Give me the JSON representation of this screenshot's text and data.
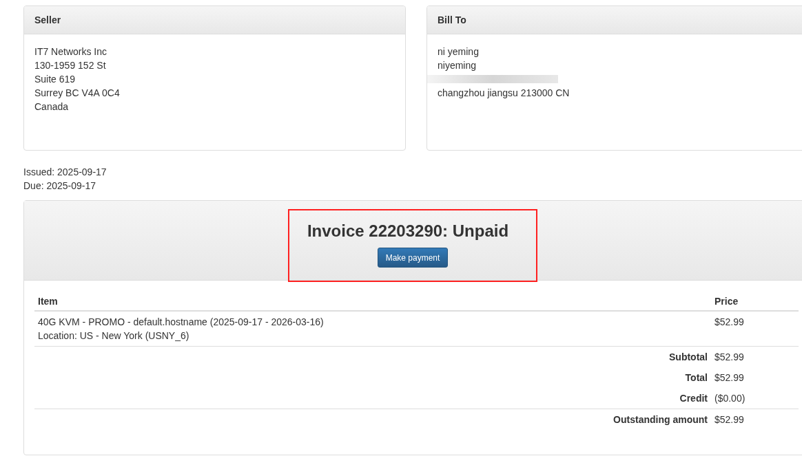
{
  "seller": {
    "title": "Seller",
    "lines": [
      "IT7 Networks Inc",
      "130-1959 152 St",
      "Suite 619",
      "Surrey BC V4A 0C4",
      "Canada"
    ]
  },
  "bill_to": {
    "title": "Bill To",
    "lines": [
      "ni yeming",
      "niyeming",
      "changzhou jiangsu 213000 CN"
    ],
    "redacted": true
  },
  "dates": [
    "Issued: 2025-09-17",
    "Due: 2025-09-17"
  ],
  "invoice": {
    "title": "Invoice 22203290: Unpaid",
    "button": "Make payment",
    "highlighted": true
  },
  "table": {
    "columns": [
      "Item",
      "Price"
    ],
    "rows": [
      {
        "item": [
          "40G KVM - PROMO - default.hostname (2025-09-17 - 2026-03-16)",
          "Location: US - New York (USNY_6)"
        ],
        "price": "$52.99"
      }
    ],
    "totals": [
      {
        "label": "Subtotal",
        "value": "$52.99",
        "divider": false
      },
      {
        "label": "Total",
        "value": "$52.99",
        "divider": false
      },
      {
        "label": "Credit",
        "value": "($0.00)",
        "divider": false
      },
      {
        "label": "Outstanding amount",
        "value": "$52.99",
        "divider": true
      }
    ]
  }
}
